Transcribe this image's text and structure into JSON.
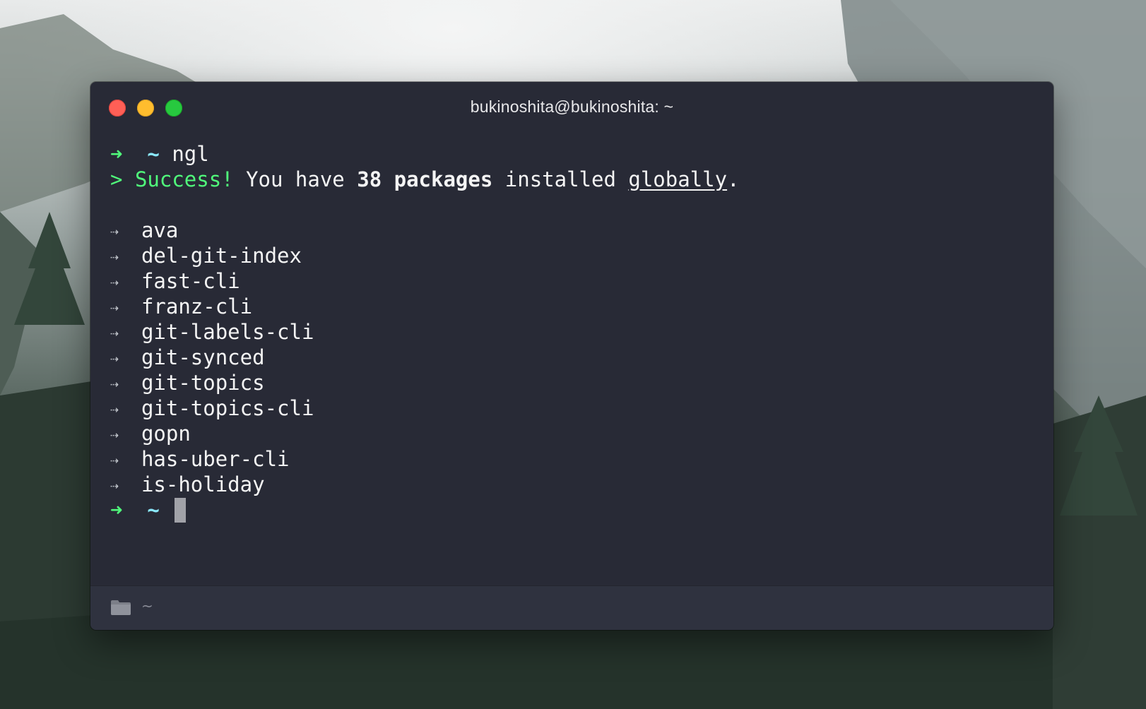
{
  "window": {
    "title": "bukinoshita@bukinoshita: ~"
  },
  "terminal": {
    "prompt_arrow": "➜",
    "prompt_dir": "~",
    "command": "ngl",
    "result": {
      "prefix": ">",
      "success": "Success!",
      "text_before": "You have",
      "count_text": "38 packages",
      "text_middle": "installed",
      "underlined": "globally",
      "text_end": "."
    },
    "list_bullet": "⇢",
    "packages": [
      "ava",
      "del-git-index",
      "fast-cli",
      "franz-cli",
      "git-labels-cli",
      "git-synced",
      "git-topics",
      "git-topics-cli",
      "gopn",
      "has-uber-cli",
      "is-holiday"
    ]
  },
  "statusbar": {
    "icon": "folder-icon",
    "path": "~"
  },
  "colors": {
    "background": "#282a36",
    "prompt_green": "#50fa7b",
    "prompt_cyan": "#8be9fd",
    "close": "#ff5f56",
    "minimize": "#ffbd2e",
    "maximize": "#27c93f"
  }
}
